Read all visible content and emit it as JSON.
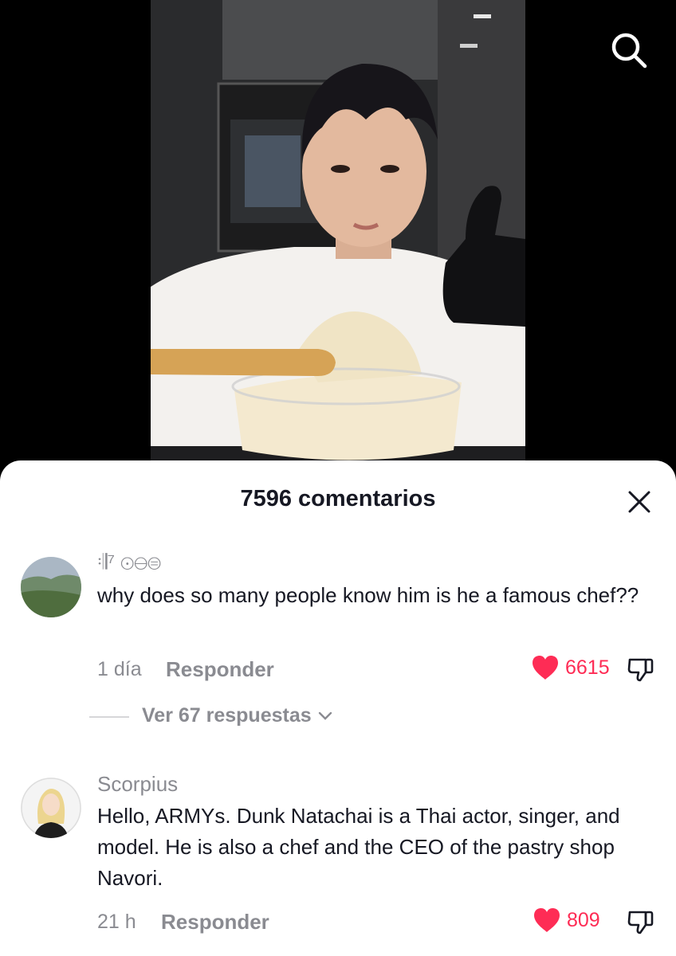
{
  "header": {
    "search_icon": "search-icon"
  },
  "comments_sheet": {
    "title": "7596 comentarios",
    "close_icon": "close-icon",
    "comments": [
      {
        "username": "𝄇⁷ ⊙⊖⊜",
        "text": "why does so many people know him is he a famous chef??",
        "time": "1 día",
        "reply_label": "Responder",
        "likes": "6615",
        "liked": true,
        "view_replies": "Ver 67 respuestas"
      },
      {
        "username": "Scorpius",
        "text": "Hello, ARMYs. Dunk Natachai is a Thai actor, singer, and model. He is also a chef and the CEO of the pastry shop Navori.",
        "time": "21 h",
        "reply_label": "Responder",
        "likes": "809",
        "liked": true
      }
    ]
  },
  "colors": {
    "like": "#fe2c55",
    "muted_text": "#8a8b91",
    "primary_text": "#161823"
  }
}
